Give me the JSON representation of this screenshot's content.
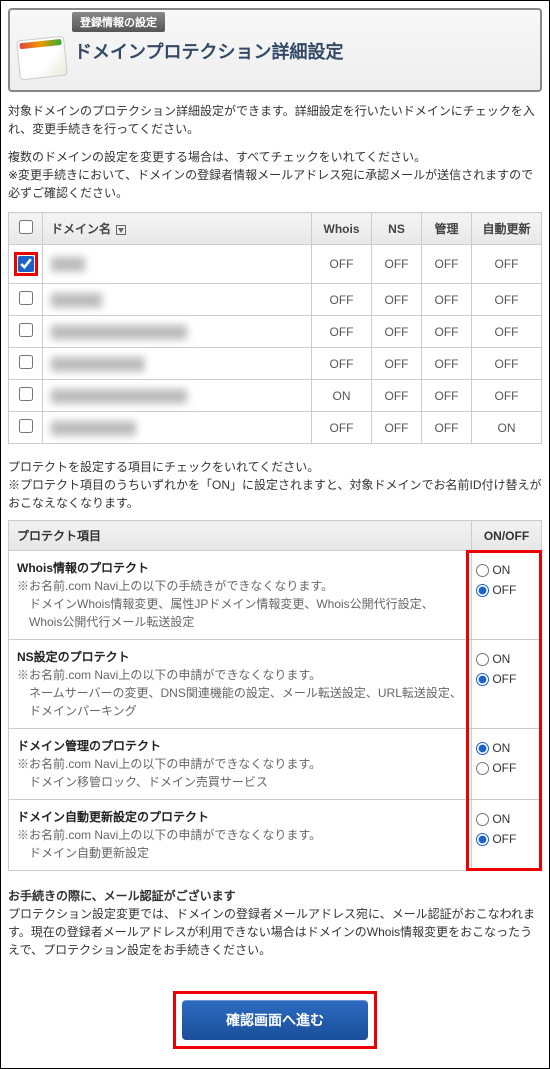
{
  "header": {
    "tab": "登録情報の設定",
    "title": "ドメインプロテクション詳細設定"
  },
  "intro": "対象ドメインのプロテクション詳細設定ができます。詳細設定を行いたいドメインにチェックを入れ、変更手続きを行ってください。",
  "note1": "複数のドメインの設定を変更する場合は、すべてチェックをいれてください。",
  "note2": "※変更手続きにおいて、ドメインの登録者情報メールアドレス宛に承認メールが送信されますので必ずご確認ください。",
  "domain_table": {
    "headers": {
      "domain": "ドメイン名",
      "whois": "Whois",
      "ns": "NS",
      "manage": "管理",
      "autorenew": "自動更新"
    },
    "rows": [
      {
        "checked": true,
        "hl": true,
        "name": "████",
        "whois": "OFF",
        "ns": "OFF",
        "manage": "OFF",
        "auto": "OFF"
      },
      {
        "checked": false,
        "hl": false,
        "name": "██████",
        "whois": "OFF",
        "ns": "OFF",
        "manage": "OFF",
        "auto": "OFF"
      },
      {
        "checked": false,
        "hl": false,
        "name": "████████████████",
        "whois": "OFF",
        "ns": "OFF",
        "manage": "OFF",
        "auto": "OFF"
      },
      {
        "checked": false,
        "hl": false,
        "name": "███████████",
        "whois": "OFF",
        "ns": "OFF",
        "manage": "OFF",
        "auto": "OFF"
      },
      {
        "checked": false,
        "hl": false,
        "name": "████████████████",
        "whois": "ON",
        "ns": "OFF",
        "manage": "OFF",
        "auto": "OFF"
      },
      {
        "checked": false,
        "hl": false,
        "name": "██████████",
        "whois": "OFF",
        "ns": "OFF",
        "manage": "OFF",
        "auto": "ON"
      }
    ]
  },
  "protect_intro1": "プロテクトを設定する項目にチェックをいれてください。",
  "protect_intro2": "※プロテクト項目のうちいずれかを「ON」に設定されますと、対象ドメインでお名前ID付け替えがおこなえなくなります。",
  "protect_table": {
    "header_item": "プロテクト項目",
    "header_onoff": "ON/OFF",
    "on_label": "ON",
    "off_label": "OFF",
    "items": [
      {
        "title": "Whois情報のプロテクト",
        "sub": "※お名前.com Navi上の以下の手続きができなくなります。",
        "detail": "ドメインWhois情報変更、属性JPドメイン情報変更、Whois公開代行設定、Whois公開代行メール転送設定",
        "selected": "OFF"
      },
      {
        "title": "NS設定のプロテクト",
        "sub": "※お名前.com Navi上の以下の申請ができなくなります。",
        "detail": "ネームサーバーの変更、DNS関連機能の設定、メール転送設定、URL転送設定、ドメインパーキング",
        "selected": "OFF"
      },
      {
        "title": "ドメイン管理のプロテクト",
        "sub": "※お名前.com Navi上の以下の申請ができなくなります。",
        "detail": "ドメイン移管ロック、ドメイン売買サービス",
        "selected": "ON"
      },
      {
        "title": "ドメイン自動更新設定のプロテクト",
        "sub": "※お名前.com Navi上の以下の申請ができなくなります。",
        "detail": "ドメイン自動更新設定",
        "selected": "OFF"
      }
    ]
  },
  "footer": {
    "bold": "お手続きの際に、メール認証がございます",
    "body": "プロテクション設定変更では、ドメインの登録者メールアドレス宛に、メール認証がおこなわれます。現在の登録者メールアドレスが利用できない場合はドメインのWhois情報変更をおこなったうえで、プロテクション設定をお手続きください。"
  },
  "button": "確認画面へ進む"
}
